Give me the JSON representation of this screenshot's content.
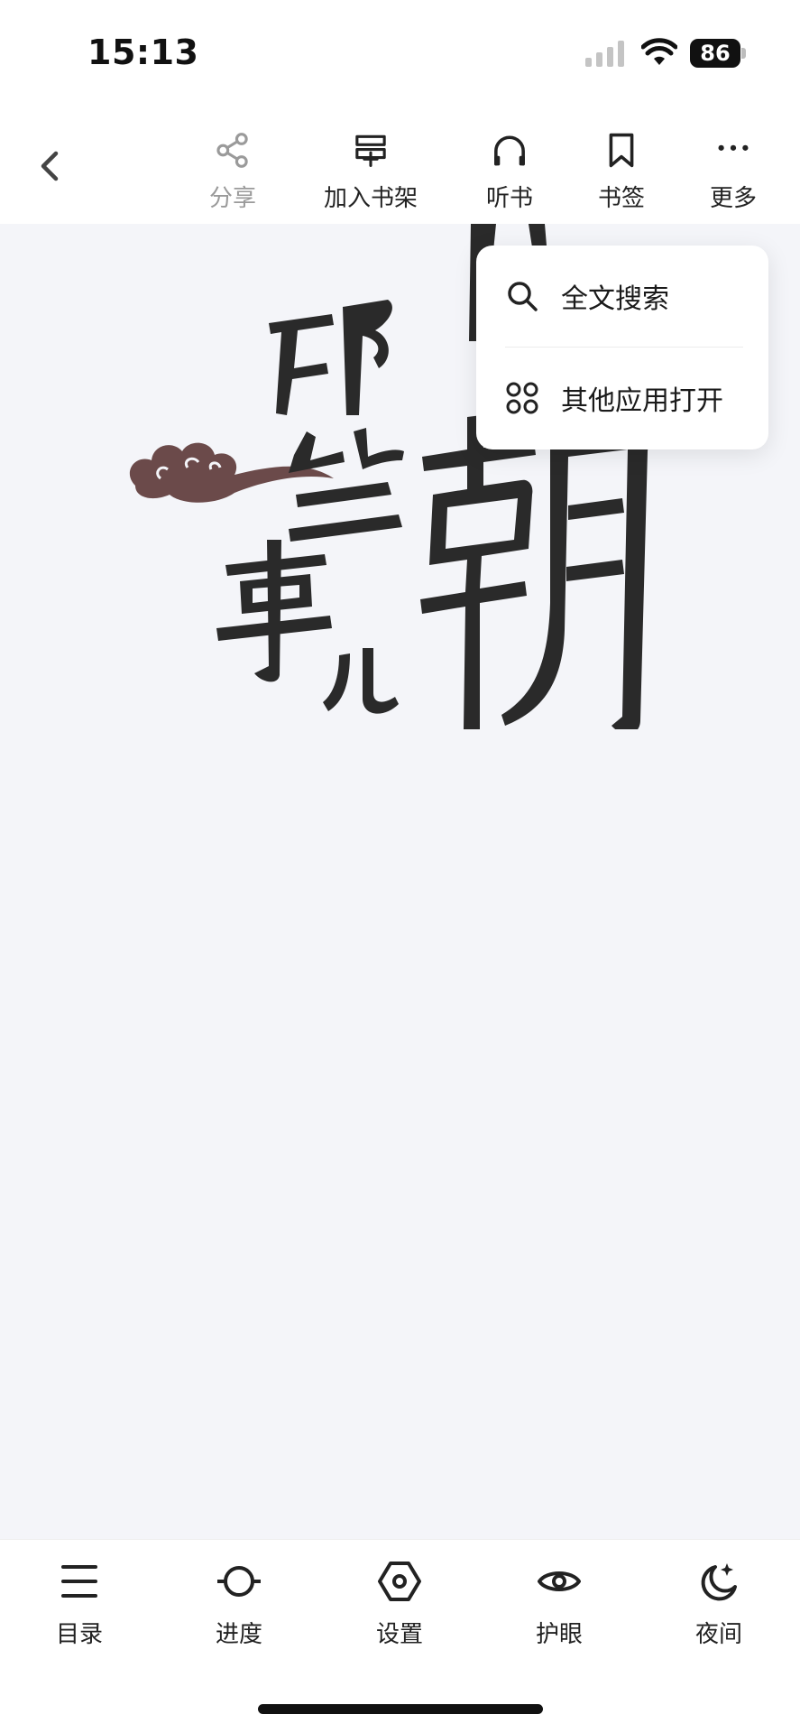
{
  "status_bar": {
    "time": "15:13",
    "battery": "86"
  },
  "toolbar": {
    "share_label": "分享",
    "add_shelf_label": "加入书架",
    "listen_label": "听书",
    "bookmark_label": "书签",
    "more_label": "更多"
  },
  "menu": {
    "items": [
      {
        "label": "全文搜索",
        "icon": "search-icon"
      },
      {
        "label": "其他应用打开",
        "icon": "apps-grid-icon"
      }
    ]
  },
  "bottom_bar": {
    "items": [
      {
        "label": "目录",
        "icon": "list-icon"
      },
      {
        "label": "进度",
        "icon": "progress-icon"
      },
      {
        "label": "设置",
        "icon": "settings-hexagon-icon"
      },
      {
        "label": "护眼",
        "icon": "eye-icon"
      },
      {
        "label": "夜间",
        "icon": "moon-icon"
      }
    ]
  },
  "colors": {
    "accent_cloud": "#6b4a4a",
    "text_muted": "#9a9a9a",
    "page_bg": "#f4f5f9"
  }
}
